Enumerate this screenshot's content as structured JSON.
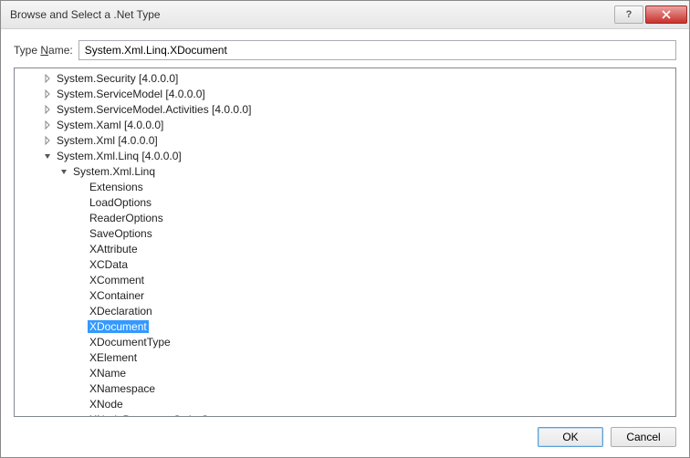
{
  "window": {
    "title": "Browse and Select a .Net Type"
  },
  "field": {
    "label_prefix": "Type ",
    "label_underlined": "N",
    "label_suffix": "ame:",
    "value": "System.Xml.Linq.XDocument"
  },
  "buttons": {
    "ok": "OK",
    "cancel": "Cancel"
  },
  "tree": [
    {
      "level": 1,
      "expand": "closed",
      "label": "System.Security [4.0.0.0]",
      "selected": false
    },
    {
      "level": 1,
      "expand": "closed",
      "label": "System.ServiceModel [4.0.0.0]",
      "selected": false
    },
    {
      "level": 1,
      "expand": "closed",
      "label": "System.ServiceModel.Activities [4.0.0.0]",
      "selected": false
    },
    {
      "level": 1,
      "expand": "closed",
      "label": "System.Xaml [4.0.0.0]",
      "selected": false
    },
    {
      "level": 1,
      "expand": "closed",
      "label": "System.Xml [4.0.0.0]",
      "selected": false
    },
    {
      "level": 1,
      "expand": "open",
      "label": "System.Xml.Linq [4.0.0.0]",
      "selected": false
    },
    {
      "level": 2,
      "expand": "open",
      "label": "System.Xml.Linq",
      "selected": false
    },
    {
      "level": 3,
      "expand": "none",
      "label": "Extensions",
      "selected": false
    },
    {
      "level": 3,
      "expand": "none",
      "label": "LoadOptions",
      "selected": false
    },
    {
      "level": 3,
      "expand": "none",
      "label": "ReaderOptions",
      "selected": false
    },
    {
      "level": 3,
      "expand": "none",
      "label": "SaveOptions",
      "selected": false
    },
    {
      "level": 3,
      "expand": "none",
      "label": "XAttribute",
      "selected": false
    },
    {
      "level": 3,
      "expand": "none",
      "label": "XCData",
      "selected": false
    },
    {
      "level": 3,
      "expand": "none",
      "label": "XComment",
      "selected": false
    },
    {
      "level": 3,
      "expand": "none",
      "label": "XContainer",
      "selected": false
    },
    {
      "level": 3,
      "expand": "none",
      "label": "XDeclaration",
      "selected": false
    },
    {
      "level": 3,
      "expand": "none",
      "label": "XDocument",
      "selected": true
    },
    {
      "level": 3,
      "expand": "none",
      "label": "XDocumentType",
      "selected": false
    },
    {
      "level": 3,
      "expand": "none",
      "label": "XElement",
      "selected": false
    },
    {
      "level": 3,
      "expand": "none",
      "label": "XName",
      "selected": false
    },
    {
      "level": 3,
      "expand": "none",
      "label": "XNamespace",
      "selected": false
    },
    {
      "level": 3,
      "expand": "none",
      "label": "XNode",
      "selected": false
    },
    {
      "level": 3,
      "expand": "none",
      "label": "XNodeDocumentOrderComparer",
      "selected": false
    }
  ],
  "tree_config": {
    "base_indent": 30,
    "per_level": 18
  }
}
